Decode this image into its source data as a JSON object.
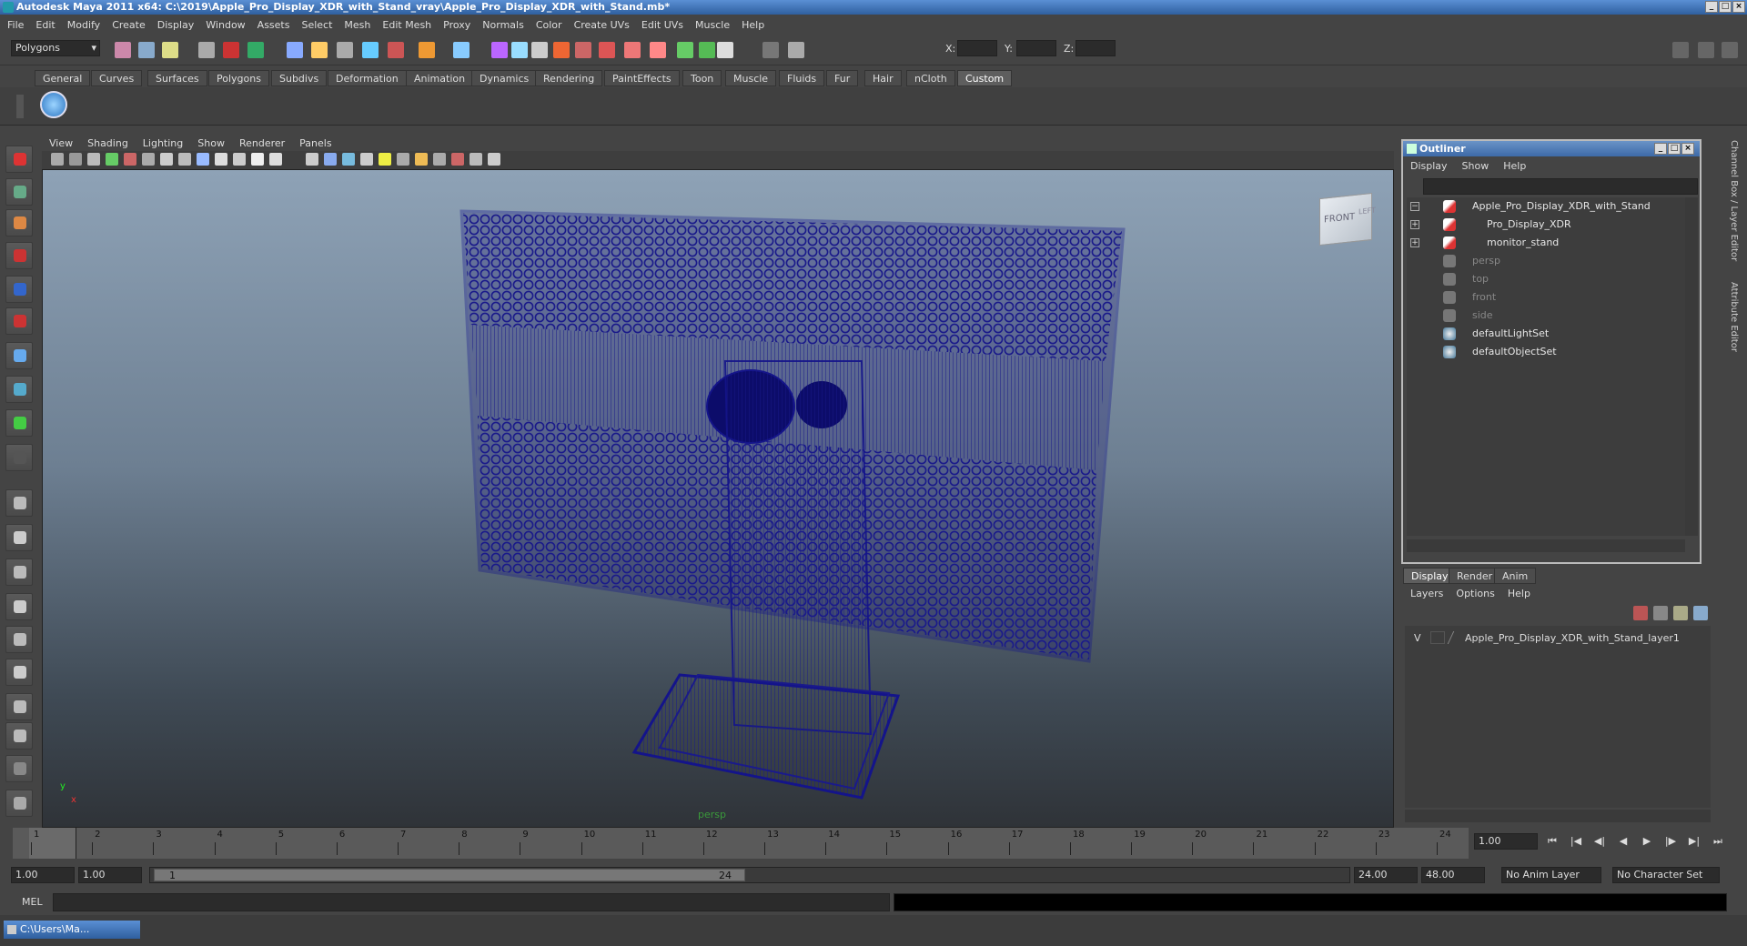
{
  "window": {
    "title": "Autodesk Maya 2011 x64: C:\\2019\\Apple_Pro_Display_XDR_with_Stand_vray\\Apple_Pro_Display_XDR_with_Stand.mb*"
  },
  "menu": [
    "File",
    "Edit",
    "Modify",
    "Create",
    "Display",
    "Window",
    "Assets",
    "Select",
    "Mesh",
    "Edit Mesh",
    "Proxy",
    "Normals",
    "Color",
    "Create UVs",
    "Edit UVs",
    "Muscle",
    "Help"
  ],
  "status": {
    "mode": "Polygons",
    "x_label": "X:",
    "y_label": "Y:",
    "z_label": "Z:"
  },
  "shelf_tabs": [
    "General",
    "Curves",
    "Surfaces",
    "Polygons",
    "Subdivs",
    "Deformation",
    "Animation",
    "Dynamics",
    "Rendering",
    "PaintEffects",
    "Toon",
    "Muscle",
    "Fluids",
    "Fur",
    "Hair",
    "nCloth",
    "Custom"
  ],
  "active_shelf": "Custom",
  "viewport": {
    "menu": [
      "View",
      "Shading",
      "Lighting",
      "Show",
      "Renderer",
      "Panels"
    ],
    "camera": "persp",
    "cube_front": "FRONT",
    "cube_side": "LEFT",
    "axis_y": "y",
    "axis_x": "x"
  },
  "outliner": {
    "title": "Outliner",
    "menu": [
      "Display",
      "Show",
      "Help"
    ],
    "items": [
      {
        "label": "Apple_Pro_Display_XDR_with_Stand",
        "kind": "transform",
        "dim": false
      },
      {
        "label": "Pro_Display_XDR",
        "kind": "transform",
        "dim": false
      },
      {
        "label": "monitor_stand",
        "kind": "transform",
        "dim": false
      },
      {
        "label": "persp",
        "kind": "camera",
        "dim": true
      },
      {
        "label": "top",
        "kind": "camera",
        "dim": true
      },
      {
        "label": "front",
        "kind": "camera",
        "dim": true
      },
      {
        "label": "side",
        "kind": "camera",
        "dim": true
      },
      {
        "label": "defaultLightSet",
        "kind": "set",
        "dim": false
      },
      {
        "label": "defaultObjectSet",
        "kind": "set",
        "dim": false
      }
    ]
  },
  "side_tabs": [
    "Channel Box / Layer Editor",
    "Attribute Editor"
  ],
  "layers": {
    "tabs": [
      "Display",
      "Render",
      "Anim"
    ],
    "active_tab": "Display",
    "menu": [
      "Layers",
      "Options",
      "Help"
    ],
    "row_visible": "V",
    "row_label": "Apple_Pro_Display_XDR_with_Stand_layer1"
  },
  "timeline": {
    "ticks": [
      "1",
      "2",
      "3",
      "4",
      "5",
      "6",
      "7",
      "8",
      "9",
      "10",
      "11",
      "12",
      "13",
      "14",
      "15",
      "16",
      "17",
      "18",
      "19",
      "20",
      "21",
      "22",
      "23",
      "24"
    ],
    "current_frame": "1.00"
  },
  "range": {
    "start": "1.00",
    "start2": "1.00",
    "slider_start": "1",
    "slider_end": "24",
    "end": "24.00",
    "end2": "48.00",
    "anim_layer": "No Anim Layer",
    "char_set": "No Character Set"
  },
  "cmdline": {
    "label": "MEL"
  },
  "taskbar": {
    "label": "C:\\Users\\Ma..."
  }
}
